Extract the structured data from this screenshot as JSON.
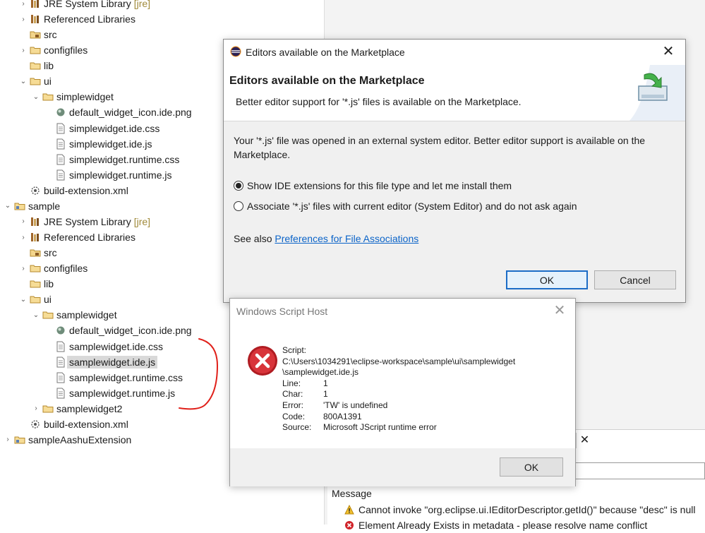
{
  "tree": {
    "items": [
      {
        "label": "JRE System Library",
        "deco": "[jre]",
        "icon": "library-icon",
        "twisty": "›"
      },
      {
        "label": "Referenced Libraries",
        "icon": "library-icon",
        "twisty": "›"
      },
      {
        "label": "src",
        "icon": "package-folder-icon",
        "twisty": ""
      },
      {
        "label": "configfiles",
        "icon": "folder-icon",
        "twisty": "›"
      },
      {
        "label": "lib",
        "icon": "folder-icon",
        "twisty": ""
      },
      {
        "label": "ui",
        "icon": "folder-icon",
        "twisty": "⌄"
      },
      {
        "label": "simplewidget",
        "icon": "folder-icon",
        "twisty": "⌄"
      },
      {
        "label": "default_widget_icon.ide.png",
        "icon": "image-file-icon",
        "twisty": ""
      },
      {
        "label": "simplewidget.ide.css",
        "icon": "file-icon",
        "twisty": ""
      },
      {
        "label": "simplewidget.ide.js",
        "icon": "file-icon",
        "twisty": ""
      },
      {
        "label": "simplewidget.runtime.css",
        "icon": "file-icon",
        "twisty": ""
      },
      {
        "label": "simplewidget.runtime.js",
        "icon": "file-icon",
        "twisty": ""
      },
      {
        "label": "build-extension.xml",
        "icon": "xml-file-icon",
        "twisty": ""
      },
      {
        "label": "sample",
        "icon": "project-icon",
        "twisty": "⌄"
      },
      {
        "label": "JRE System Library",
        "deco": "[jre]",
        "icon": "library-icon",
        "twisty": "›"
      },
      {
        "label": "Referenced Libraries",
        "icon": "library-icon",
        "twisty": "›"
      },
      {
        "label": "src",
        "icon": "package-folder-icon",
        "twisty": ""
      },
      {
        "label": "configfiles",
        "icon": "folder-icon",
        "twisty": "›"
      },
      {
        "label": "lib",
        "icon": "folder-icon",
        "twisty": ""
      },
      {
        "label": "ui",
        "icon": "folder-icon",
        "twisty": "⌄"
      },
      {
        "label": "samplewidget",
        "icon": "folder-icon",
        "twisty": "⌄"
      },
      {
        "label": "default_widget_icon.ide.png",
        "icon": "image-file-icon",
        "twisty": ""
      },
      {
        "label": "samplewidget.ide.css",
        "icon": "file-icon",
        "twisty": ""
      },
      {
        "label": "samplewidget.ide.js",
        "icon": "file-icon",
        "twisty": "",
        "selected": true
      },
      {
        "label": "samplewidget.runtime.css",
        "icon": "file-icon",
        "twisty": ""
      },
      {
        "label": "samplewidget.runtime.js",
        "icon": "file-icon",
        "twisty": ""
      },
      {
        "label": "samplewidget2",
        "icon": "folder-icon",
        "twisty": "›"
      },
      {
        "label": "build-extension.xml",
        "icon": "xml-file-icon",
        "twisty": ""
      },
      {
        "label": "sampleAashuExtension",
        "icon": "project-icon",
        "twisty": "›"
      }
    ]
  },
  "marketplace_dialog": {
    "window_title": "Editors available on the Marketplace",
    "heading": "Editors available on the Marketplace",
    "subheading": "Better editor support for '*.js' files is available on the Marketplace.",
    "body": "Your '*.js' file was opened in an external system editor. Better editor support is available on the Marketplace.",
    "option_show": "Show IDE extensions for this file type and let me install them",
    "option_associate": "Associate '*.js' files with current editor (System Editor) and do not ask again",
    "see_also_prefix": "See also",
    "see_also_link": "Preferences for File Associations",
    "ok_label": "OK",
    "cancel_label": "Cancel",
    "close_glyph": "✕"
  },
  "wsh_dialog": {
    "window_title": "Windows Script Host",
    "close_glyph": "✕",
    "script_label": "Script:",
    "script_path_1": "C:\\Users\\1034291\\eclipse-workspace\\sample\\ui\\samplewidget",
    "script_path_2": "\\samplewidget.ide.js",
    "fields": [
      {
        "key": "Line:",
        "value": "1"
      },
      {
        "key": "Char:",
        "value": "1"
      },
      {
        "key": "Error:",
        "value": "'TW' is undefined"
      },
      {
        "key": "Code:",
        "value": "800A1391"
      },
      {
        "key": "Source:",
        "value": "Microsoft JScript runtime error"
      }
    ],
    "ok_label": "OK"
  },
  "problems": {
    "tab_close_glyph": "✕",
    "column_header": "Message",
    "rows": [
      {
        "text": "Cannot invoke \"org.eclipse.ui.IEditorDescriptor.getId()\" because \"desc\" is null",
        "icon": "warning-icon"
      },
      {
        "text": "Element Already Exists in metadata - please resolve name conflict",
        "icon": "error-icon"
      }
    ]
  },
  "colors": {
    "selection": "#d9d9d9",
    "link": "#0a63c8",
    "default_button_border": "#1c6cc6",
    "error_red": "#d0242a",
    "annotation_red": "#e0201a"
  }
}
